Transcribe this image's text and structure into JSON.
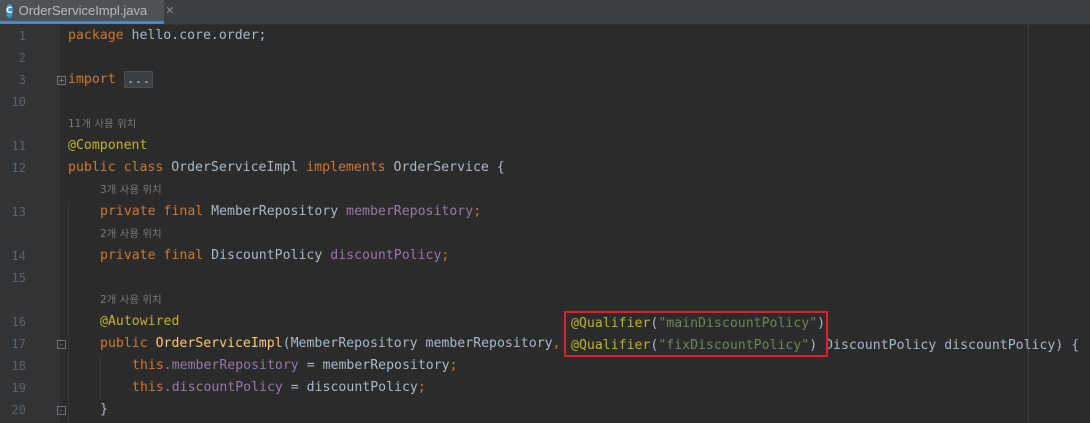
{
  "tab": {
    "title": "OrderServiceImpl.java",
    "icon": "C",
    "close": "✕"
  },
  "gutter": {
    "line_numbers": [
      "1",
      "2",
      "3",
      "10",
      "11",
      "12",
      "13",
      "14",
      "15",
      "16",
      "17",
      "18",
      "19",
      "20"
    ]
  },
  "hints": {
    "class_usages": "11개 사용 위치",
    "member_repo_usages": "3개 사용 위치",
    "discount_policy_usages": "2개 사용 위치",
    "constructor_usages": "2개 사용 위치"
  },
  "code": {
    "l1_kw": "package",
    "l1_rest": " hello.core.order;",
    "l3_kw": "import",
    "l3_fold": "...",
    "l11_ann": "@Component",
    "l12_kw1": "public class ",
    "l12_name": "OrderServiceImpl ",
    "l12_kw2": "implements ",
    "l12_rest": "OrderService {",
    "l13_kw": "private final ",
    "l13_type": "MemberRepository ",
    "l13_field": "memberRepository",
    "l13_semi": ";",
    "l14_kw": "private final ",
    "l14_type": "DiscountPolicy ",
    "l14_field": "discountPolicy",
    "l14_semi": ";",
    "l16_ann": "@Autowired",
    "l16_q_ann": "@Qualifier",
    "l16_q_open": "(",
    "l16_q_str": "\"mainDiscountPolicy\"",
    "l16_q_close": ")",
    "l17_kw": "public ",
    "l17_fn": "OrderServiceImpl",
    "l17_params": "(MemberRepository memberRepository",
    "l17_comma": ", ",
    "l17_q_ann": "@Qualifier",
    "l17_q_open": "(",
    "l17_q_str": "\"fixDiscountPolicy\"",
    "l17_q_close": ")",
    "l17_rest": " DiscountPolicy discountPolicy) {",
    "l18_this": "this",
    "l18_field": ".memberRepository",
    "l18_rest": " = memberRepository",
    "l18_semi": ";",
    "l19_this": "this",
    "l19_field": ".discountPolicy",
    "l19_rest": " = discountPolicy",
    "l19_semi": ";",
    "l20_brace": "}"
  }
}
